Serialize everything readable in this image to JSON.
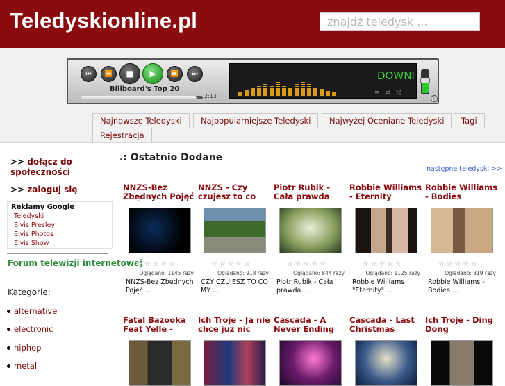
{
  "site": {
    "logo": "Teledyskionline.pl"
  },
  "search": {
    "placeholder": "znajdź teledysk ..."
  },
  "player": {
    "track_title": "Billboard's Top 20",
    "time": "2:13",
    "scroll_text": "DOWNI",
    "progress": 0.95,
    "volume": 0.45
  },
  "tabs": [
    {
      "label": "Najnowsze Teledyski"
    },
    {
      "label": "Najpopularniejsze Teledyski"
    },
    {
      "label": "Najwyżej Oceniane Teledyski"
    },
    {
      "label": "Tagi"
    },
    {
      "label": "Rejestracja"
    }
  ],
  "sidebar": {
    "join_arrow": ">>",
    "join_label": "dołącz do społeczności",
    "login_arrow": ">>",
    "login_label": "zaloguj się",
    "ads_header": "Reklamy Google",
    "ads": [
      "Teledyski",
      "Elvis Presley",
      "Elvis Photos",
      "Elvis Show"
    ],
    "forum": "Forum telewizji internetowej",
    "categories_label": "Kategorie:",
    "categories": [
      "alternative",
      "electronic",
      "hiphop",
      "metal"
    ]
  },
  "main": {
    "title": ".: Ostatnio Dodane",
    "next_link": "następne teledyski >>",
    "cards": [
      {
        "title": "NNZS-Bez Zbędnych Pojęć",
        "views": "Oglądano: 1145 razy",
        "desc": "NNZS-Bez Zbędnych Pojęć ...",
        "rating": 0
      },
      {
        "title": "NNZS - Czy czujesz to co my",
        "views": "Oglądano: 918 razy",
        "desc": "CZY CZUJESZ TO CO MY ...",
        "rating": 0
      },
      {
        "title": "Piotr Rubik - Cała prawda",
        "views": "Oglądano: 844 razy",
        "desc": "Piotr Rubik - Cała prawda ...",
        "rating": 0
      },
      {
        "title": "Robbie Williams - Eternity",
        "views": "Oglądano: 1125 razy",
        "desc": "Robbie Williams \"Eternity\" ...",
        "rating": 0
      },
      {
        "title": "Robbie Williams - Bodies",
        "views": "Oglądano: 819 razy",
        "desc": "Robbie Williams - Bodies ...",
        "rating": 0
      },
      {
        "title": "Fatal Bazooka Feat Yelle - Parle"
      },
      {
        "title": "Ich Troje - Ja nie chce juz nic"
      },
      {
        "title": "Cascada - A Never Ending"
      },
      {
        "title": "Cascada - Last Christmas"
      },
      {
        "title": "Ich Troje - Ding Dong"
      }
    ]
  },
  "colors": {
    "header": "#8b0c0f",
    "accent": "#7a0a0a",
    "forum": "#2e8b3a",
    "link": "#3a5fcf"
  },
  "icons": [
    "prev-icon",
    "rewind-icon",
    "stop-icon",
    "play-icon",
    "forward-icon",
    "next-icon",
    "star-icon"
  ]
}
